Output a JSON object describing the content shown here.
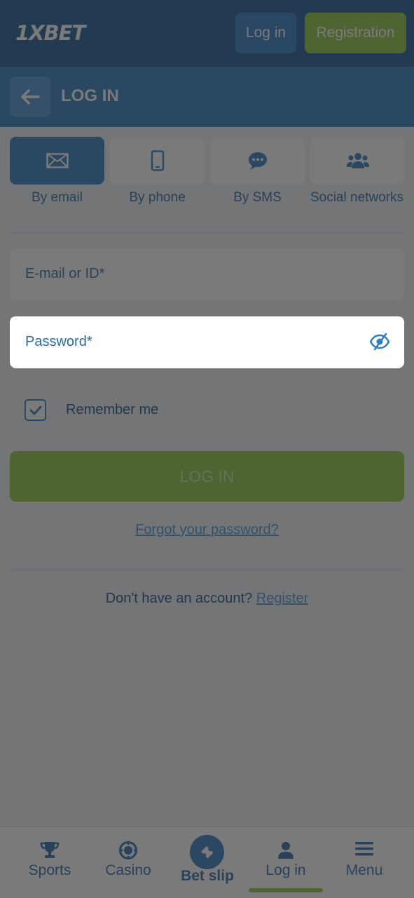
{
  "topbar": {
    "logo": "1XBET",
    "login_label": "Log in",
    "registration_label": "Registration"
  },
  "header": {
    "title": "LOG IN"
  },
  "tabs": [
    {
      "label": "By email",
      "icon": "envelope-icon",
      "active": true
    },
    {
      "label": "By phone",
      "icon": "phone-icon",
      "active": false
    },
    {
      "label": "By SMS",
      "icon": "sms-icon",
      "active": false
    },
    {
      "label": "Social networks",
      "icon": "users-icon",
      "active": false
    }
  ],
  "form": {
    "email_placeholder": "E-mail or ID*",
    "password_placeholder": "Password*",
    "remember_label": "Remember me",
    "remember_checked": true,
    "login_button": "LOG IN",
    "forgot_link": "Forgot your password?",
    "no_account_text": "Don't have an account?",
    "register_link": "Register"
  },
  "bottom_nav": {
    "items": [
      {
        "label": "Sports",
        "icon": "trophy-icon"
      },
      {
        "label": "Casino",
        "icon": "casino-chip-icon"
      },
      {
        "label": "Bet slip",
        "icon": "ticket-icon"
      },
      {
        "label": "Log in",
        "icon": "user-icon",
        "active": true
      },
      {
        "label": "Menu",
        "icon": "hamburger-icon"
      }
    ]
  },
  "colors": {
    "brand_dark": "#1a5b93",
    "brand_blue": "#2f7dc1",
    "accent_green": "#8dc63f",
    "overlay": "rgba(40,40,40,0.62)"
  }
}
